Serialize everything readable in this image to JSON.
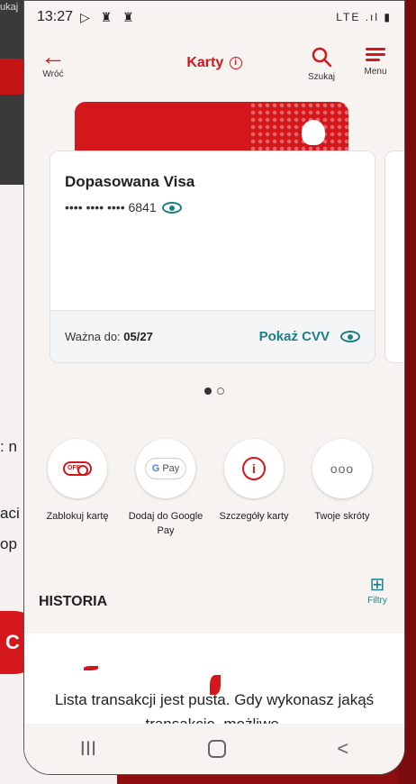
{
  "background": {
    "left_tab_text": "ukaj",
    "left_text_1": ": n",
    "left_text_2": "aci",
    "left_text_3": "op",
    "left_button": "C"
  },
  "status_bar": {
    "time": "13:27",
    "left_icons": "▷ ♜ ♜",
    "right_icons": "LTE .ıl ▮"
  },
  "header": {
    "back_label": "Wróć",
    "title": "Karty",
    "search_label": "Szukaj",
    "menu_label": "Menu"
  },
  "card": {
    "name": "Dopasowana Visa",
    "number": "•••• •••• •••• 6841",
    "valid_label": "Ważna do:",
    "valid_value": "05/27",
    "show_cvv": "Pokaż CVV"
  },
  "actions": [
    {
      "label": "Zablokuj kartę",
      "icon": "off-toggle-icon"
    },
    {
      "label": "Dodaj do Google Pay",
      "icon": "google-pay-icon"
    },
    {
      "label": "Szczegóły karty",
      "icon": "info-icon"
    },
    {
      "label": "Twoje skróty",
      "icon": "more-icon"
    }
  ],
  "action_icon_text": {
    "off": "OFF",
    "gpay_g": "G",
    "gpay_pay": "Pay",
    "info": "i",
    "more": "ooo"
  },
  "history": {
    "title": "HISTORIA",
    "filter_label": "Filtry",
    "empty_text": "Lista transakcji jest pusta. Gdy wykonasz jakąś transakcję, możliwe,"
  },
  "nav": {
    "recents": "III",
    "back": "<"
  },
  "colors": {
    "accent": "#d4171b",
    "teal": "#1d7f86"
  }
}
